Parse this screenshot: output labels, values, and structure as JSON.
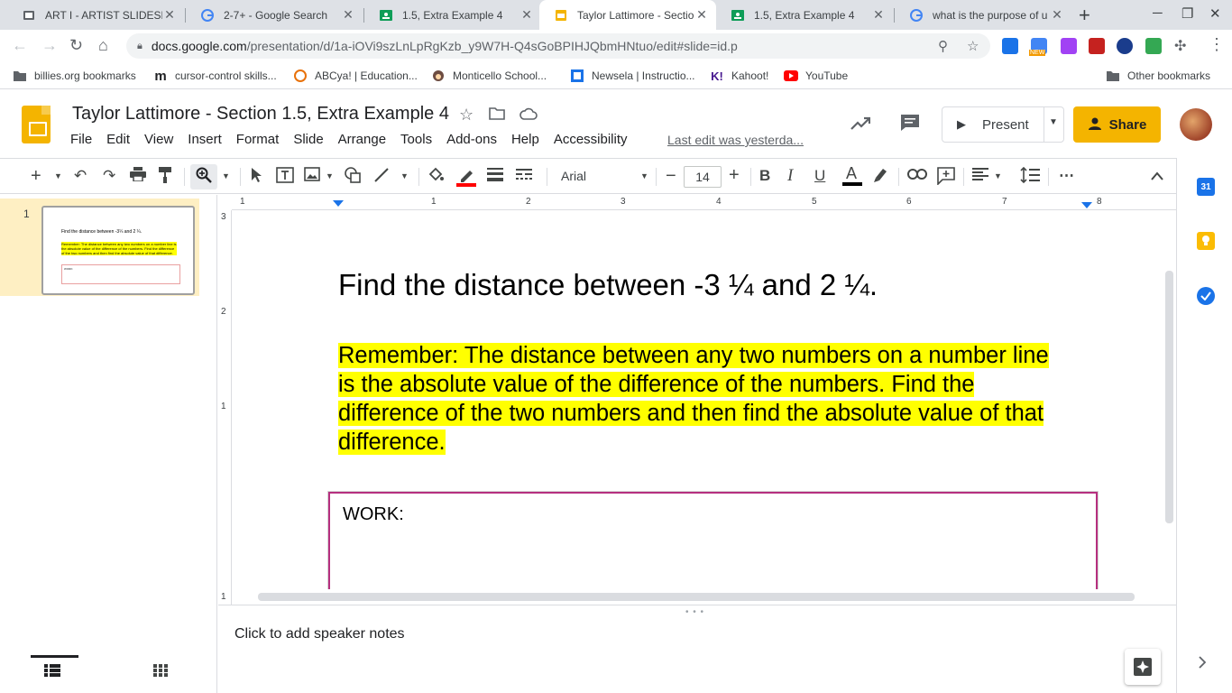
{
  "browser": {
    "tabs": [
      {
        "title": "ART I - ARTIST SLIDESHOW",
        "icon": "slides-icon",
        "active": false
      },
      {
        "title": "2-7+ - Google Search",
        "icon": "google-icon",
        "active": false
      },
      {
        "title": "1.5, Extra Example 4",
        "icon": "classroom-icon",
        "active": false
      },
      {
        "title": "Taylor Lattimore - Section",
        "icon": "slides-icon",
        "active": true
      },
      {
        "title": "1.5, Extra Example 4",
        "icon": "classroom-icon",
        "active": false
      },
      {
        "title": "what is the purpose of u",
        "icon": "google-icon",
        "active": false
      }
    ],
    "url_host": "docs.google.com",
    "url_path": "/presentation/d/1a-iOVi9szLnLpRgKzb_y9W7H-Q4sGoBPIHJQbmHNtuo/edit#slide=id.p",
    "bookmarks": [
      {
        "label": "billies.org bookmarks"
      },
      {
        "label": "cursor-control skills..."
      },
      {
        "label": "ABCya! | Education..."
      },
      {
        "label": "Monticello School..."
      },
      {
        "label": "Newsela | Instructio..."
      },
      {
        "label": "Kahoot!"
      },
      {
        "label": "YouTube"
      }
    ],
    "other_bookmarks": "Other bookmarks",
    "new_badge": "NEW"
  },
  "doc": {
    "title": "Taylor Lattimore - Section 1.5,  Extra Example 4",
    "menu": [
      "File",
      "Edit",
      "View",
      "Insert",
      "Format",
      "Slide",
      "Arrange",
      "Tools",
      "Add-ons",
      "Help",
      "Accessibility"
    ],
    "last_edit": "Last edit was yesterda...",
    "present_label": "Present",
    "share_label": "Share",
    "accent_color": "#f4b400"
  },
  "toolbar": {
    "font_name": "Arial",
    "font_size": "14"
  },
  "ruler": {
    "h_labels": [
      "1",
      "1",
      "2",
      "3",
      "4",
      "5",
      "6",
      "7",
      "8"
    ],
    "v_labels": [
      "3",
      "2",
      "1",
      "1"
    ]
  },
  "filmstrip": {
    "slide_number": "1",
    "thumb_title": "Find the distance between -3¼ and 2 ¼.",
    "thumb_reminder": "Remember: The distance between any two numbers on a number line is the absolute value of the difference of the numbers. Find the difference of the two numbers and then find the absolute value of that difference.",
    "thumb_work": "WORK:"
  },
  "slide": {
    "heading": "Find the distance between  -3 ¼ and 2 ¼.",
    "reminder_lines": [
      "Remember:  The distance between any two numbers on a number line",
      "is the absolute value of the difference of the numbers.  Find the",
      "difference of the two numbers and then find the absolute value of that",
      "difference."
    ],
    "work_label": "WORK:",
    "highlight_color": "#ffff00",
    "work_border_color": "#b6307f"
  },
  "notes": {
    "placeholder": "Click to add speaker notes"
  }
}
